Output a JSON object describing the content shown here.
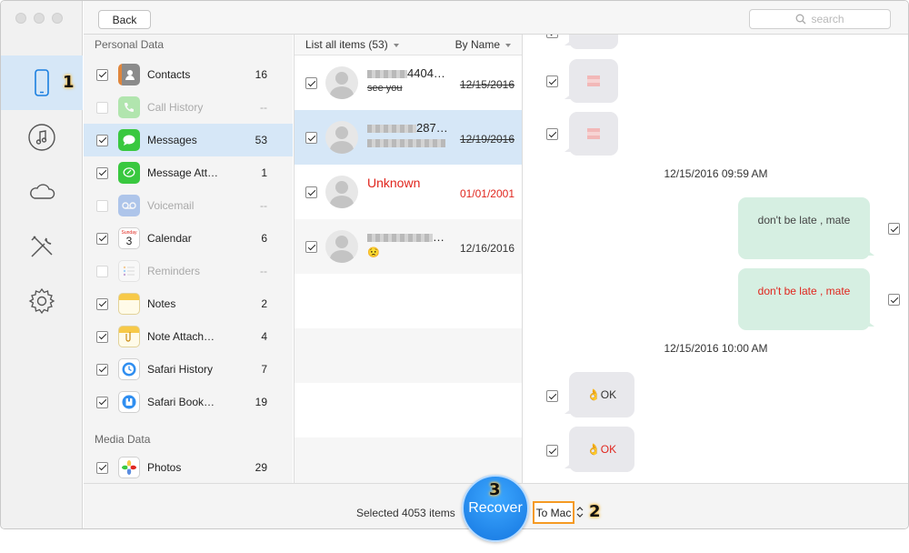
{
  "toolbar": {
    "back_label": "Back",
    "search_placeholder": "search"
  },
  "steps": {
    "one": "1",
    "two": "2",
    "three": "3"
  },
  "rail": {
    "items": [
      {
        "name": "device",
        "icon": "iphone-icon",
        "active": true
      },
      {
        "name": "music",
        "icon": "music-note-icon"
      },
      {
        "name": "cloud",
        "icon": "cloud-icon"
      },
      {
        "name": "tools",
        "icon": "tools-icon"
      },
      {
        "name": "settings",
        "icon": "gear-icon"
      }
    ]
  },
  "categories": {
    "personal_title": "Personal Data",
    "media_title": "Media Data",
    "items": [
      {
        "label": "Contacts",
        "count": "16",
        "checked": true,
        "icon": "contacts-icon"
      },
      {
        "label": "Call History",
        "count": "--",
        "checked": false,
        "disabled": true,
        "icon": "phone-icon"
      },
      {
        "label": "Messages",
        "count": "53",
        "checked": true,
        "selected": true,
        "icon": "messages-icon"
      },
      {
        "label": "Message Att…",
        "count": "1",
        "checked": true,
        "icon": "message-attachment-icon"
      },
      {
        "label": "Voicemail",
        "count": "--",
        "checked": false,
        "disabled": true,
        "icon": "voicemail-icon"
      },
      {
        "label": "Calendar",
        "count": "6",
        "checked": true,
        "icon": "calendar-icon"
      },
      {
        "label": "Reminders",
        "count": "--",
        "checked": false,
        "disabled": true,
        "icon": "reminders-icon"
      },
      {
        "label": "Notes",
        "count": "2",
        "checked": true,
        "icon": "notes-icon"
      },
      {
        "label": "Note Attach…",
        "count": "4",
        "checked": true,
        "icon": "note-attachment-icon"
      },
      {
        "label": "Safari History",
        "count": "7",
        "checked": true,
        "icon": "safari-history-icon"
      },
      {
        "label": "Safari Book…",
        "count": "19",
        "checked": true,
        "icon": "safari-bookmark-icon"
      }
    ],
    "media_items": [
      {
        "label": "Photos",
        "count": "29",
        "checked": true,
        "icon": "photos-icon"
      }
    ]
  },
  "list": {
    "header_left": "List all items (53)",
    "header_right": "By Name",
    "conversations": [
      {
        "name_suffix": "4404…",
        "preview": "see you",
        "date": "12/15/2016",
        "deleted": true
      },
      {
        "name_suffix": "287…",
        "preview": "",
        "date": "12/19/2016",
        "deleted": true,
        "selected": true
      },
      {
        "name": "Unknown",
        "date": "01/01/2001",
        "red": true
      },
      {
        "name_suffix": "…",
        "preview": "😟",
        "date": "12/16/2016"
      }
    ]
  },
  "messages": {
    "timestamps": [
      "12/15/2016 09:59 AM",
      "12/15/2016 10:00 AM"
    ],
    "out": [
      "don't be late , mate",
      "don't be late , mate"
    ],
    "in": [
      "👌OK",
      "👌OK"
    ]
  },
  "bottom": {
    "selected_text": "Selected 4053 items",
    "recover_label": "Recover",
    "destination": "To Mac"
  },
  "colors": {
    "accent": "#1576e0",
    "highlight": "#d6e7f7",
    "annotation": "#f59a23",
    "deleted_red": "#e0261e"
  }
}
